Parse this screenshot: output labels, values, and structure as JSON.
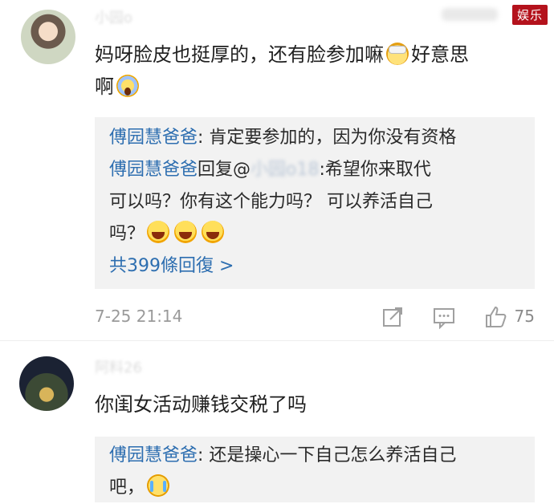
{
  "badge": {
    "text": "娱乐"
  },
  "comments": [
    {
      "username": "小园o",
      "text_parts": [
        "妈呀脸皮也挺厚的，还有脸参加嘛",
        "好意思",
        "啊"
      ],
      "emojis": [
        "sick-face-emoji",
        "screaming-face-emoji"
      ],
      "replies": [
        {
          "name": "傅园慧爸爸",
          "text": ":  肯定要参加的，因为你没有资格"
        },
        {
          "name": "傅园慧爸爸",
          "text_prefix": "回复@",
          "blurred_user": "小园o18",
          "text_line1": ":希望你来取代",
          "text_line2": "可以吗？你有这个能力吗？ 可以养活自己",
          "text_line3": "吗？"
        }
      ],
      "more_replies": "共399條回復 >",
      "timestamp": "7-25 21:14",
      "likes": "75"
    },
    {
      "username": "阿料26",
      "text": "你闺女活动赚钱交税了吗",
      "replies": [
        {
          "name": "傅园慧爸爸",
          "text_line1": ":  还是操心一下自己怎么养活自己",
          "text_line2": "吧，"
        }
      ]
    }
  ]
}
